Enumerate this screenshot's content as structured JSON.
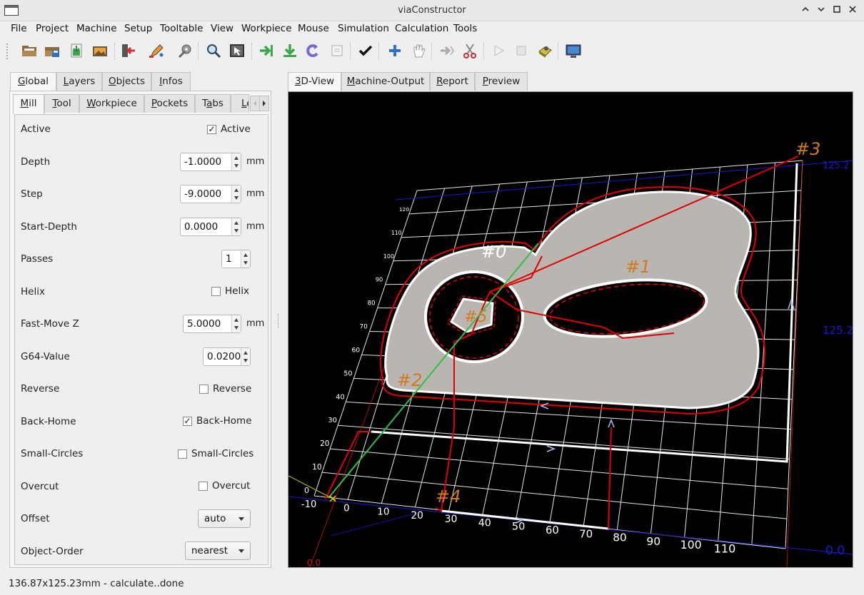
{
  "window": {
    "title": "viaConstructor",
    "controls": {
      "minimize": "⌃",
      "maximize": "⌄",
      "restore": "□",
      "close": "✕"
    }
  },
  "menu": [
    "File",
    "Project",
    "Machine",
    "Setup",
    "Tooltable",
    "View",
    "Workpiece",
    "Mouse",
    "Simulation",
    "Calculation",
    "Tools"
  ],
  "toolbar": {
    "icons": [
      "open-folder-icon",
      "save-icon",
      "load-setup-icon",
      "save-image-icon",
      "exit-icon",
      "draw-icon",
      "settings-icon",
      "zoom-icon",
      "select-icon",
      "export-icon",
      "download-icon",
      "rotate-icon",
      "blank-icon",
      "check-icon",
      "add-icon",
      "hand-icon",
      "forward-icon",
      "cut-icon",
      "play-icon",
      "stop-icon",
      "3d-object-icon",
      "monitor-icon"
    ]
  },
  "left_tabs": [
    "Global",
    "Layers",
    "Objects",
    "Infos"
  ],
  "left_tab_underline": [
    "G",
    "L",
    "O",
    "I"
  ],
  "sub_tabs": [
    "Mill",
    "Tool",
    "Workpiece",
    "Pockets",
    "Tabs",
    "Le"
  ],
  "sub_tab_underline": [
    "M",
    "T",
    "W",
    "P",
    "a",
    "L"
  ],
  "settings": {
    "active": {
      "label": "Active",
      "checkbox_label": "Active",
      "checked": true
    },
    "depth": {
      "label": "Depth",
      "value": "-1.0000",
      "unit": "mm"
    },
    "step": {
      "label": "Step",
      "value": "-9.0000",
      "unit": "mm"
    },
    "start_depth": {
      "label": "Start-Depth",
      "value": "0.0000",
      "unit": "mm"
    },
    "passes": {
      "label": "Passes",
      "value": "1"
    },
    "helix": {
      "label": "Helix",
      "checkbox_label": "Helix",
      "checked": false
    },
    "fast_move_z": {
      "label": "Fast-Move Z",
      "value": "5.0000",
      "unit": "mm"
    },
    "g64": {
      "label": "G64-Value",
      "value": "0.0200"
    },
    "reverse": {
      "label": "Reverse",
      "checkbox_label": "Reverse",
      "checked": false
    },
    "back_home": {
      "label": "Back-Home",
      "checkbox_label": "Back-Home",
      "checked": true
    },
    "small_circles": {
      "label": "Small-Circles",
      "checkbox_label": "Small-Circles",
      "checked": false
    },
    "overcut": {
      "label": "Overcut",
      "checkbox_label": "Overcut",
      "checked": false
    },
    "offset": {
      "label": "Offset",
      "value": "auto"
    },
    "object_order": {
      "label": "Object-Order",
      "value": "nearest"
    }
  },
  "check_mark": "✓",
  "right_tabs": [
    "3D-View",
    "Machine-Output",
    "Report",
    "Preview"
  ],
  "right_tab_underline": [
    "3",
    "M",
    "R",
    "P"
  ],
  "viewport": {
    "object_labels": [
      "#0",
      "#1",
      "#2",
      "#3",
      "#4",
      "#5"
    ],
    "dimension_labels": [
      "125.2",
      "125.2",
      "0.0",
      "0.0"
    ],
    "x_ticks": [
      "-10",
      "0",
      "10",
      "20",
      "30",
      "40",
      "50",
      "60",
      "70",
      "80",
      "90",
      "100",
      "110"
    ],
    "y_ticks": [
      "0",
      "10",
      "20",
      "30",
      "40",
      "50",
      "60",
      "70",
      "80",
      "90",
      "100",
      "110",
      "120"
    ]
  },
  "colors": {
    "path_red": "#e00000",
    "fast_green": "#2fbf4a",
    "label_orange": "#d07a20",
    "axis_blue": "#1a1acc"
  },
  "status": "136.87x125.23mm - calculate..done"
}
